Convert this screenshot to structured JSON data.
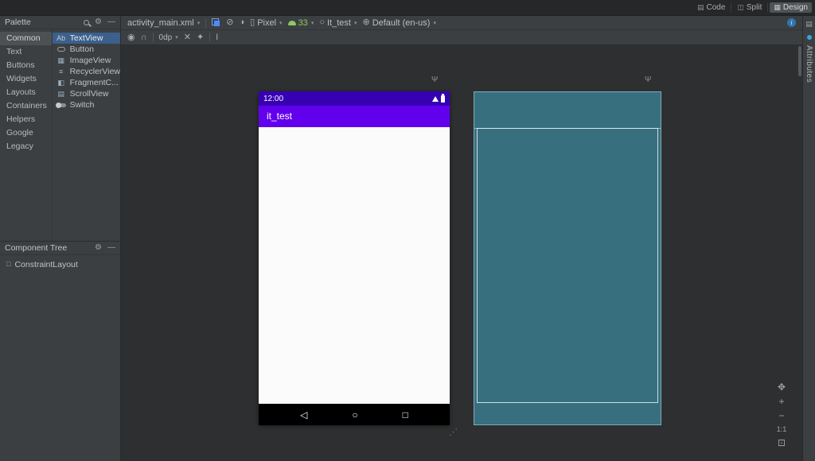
{
  "colors": {
    "accent_blue": "#4d8af8",
    "android_green": "#8fc765",
    "status_bar_purple": "#3700b3",
    "app_bar_purple": "#6200ee",
    "blueprint_teal": "#386f7f",
    "selection_blue": "#3b608c"
  },
  "titlebar": {
    "modes": [
      {
        "label": "Code"
      },
      {
        "label": "Split"
      },
      {
        "label": "Design",
        "selected": true
      }
    ]
  },
  "toolbar": {
    "file_name": "activity_main.xml",
    "device": "Pixel",
    "api_level": "33",
    "theme": "It_test",
    "locale": "Default (en-us)",
    "default_margin": "0dp"
  },
  "palette": {
    "title": "Palette",
    "categories": [
      {
        "label": "Common",
        "selected": true
      },
      {
        "label": "Text"
      },
      {
        "label": "Buttons"
      },
      {
        "label": "Widgets"
      },
      {
        "label": "Layouts"
      },
      {
        "label": "Containers"
      },
      {
        "label": "Helpers"
      },
      {
        "label": "Google"
      },
      {
        "label": "Legacy"
      }
    ],
    "items": [
      {
        "label": "TextView",
        "icon": "textview-icon",
        "glyph": "Ab",
        "selected": true
      },
      {
        "label": "Button",
        "icon": "button-icon"
      },
      {
        "label": "ImageView",
        "icon": "imageview-icon",
        "glyph": "▦"
      },
      {
        "label": "RecyclerView",
        "icon": "recyclerview-icon",
        "glyph": "≡"
      },
      {
        "label": "FragmentC...",
        "icon": "fragmentcontainerview-icon",
        "glyph": "◧"
      },
      {
        "label": "ScrollView",
        "icon": "scrollview-icon",
        "glyph": "▤"
      },
      {
        "label": "Switch",
        "icon": "switch-icon"
      }
    ]
  },
  "component_tree": {
    "title": "Component Tree",
    "items": [
      {
        "label": "ConstraintLayout",
        "icon": "constraintlayout-icon"
      }
    ]
  },
  "device_screen": {
    "status_time": "12:00",
    "app_title": "it_test"
  },
  "right_panel": {
    "label": "Attributes"
  },
  "zoom_controls": {
    "pan": "✥",
    "zoom_in": "+",
    "zoom_out": "−",
    "ratio": "1:1",
    "fit": "⊡"
  },
  "icons": {
    "code": "▤",
    "split": "◫",
    "design": "▦",
    "gear": "⚙",
    "minimize": "—",
    "chevron": "▾",
    "no_theme": "⊘",
    "color_variant": "◑",
    "device_phone": "▯",
    "theme_circle": "○",
    "locale_globe": "⊕",
    "info": "i",
    "eye": "◉",
    "magnet": "∩",
    "clear_constraints": "✕",
    "infer_constraints": "✦",
    "pack": "I",
    "antenna": "Ψ",
    "panel_toggle": "▤",
    "resize_handle": "⋰",
    "nav_back": "◁",
    "nav_home": "○",
    "nav_recents": "□"
  }
}
